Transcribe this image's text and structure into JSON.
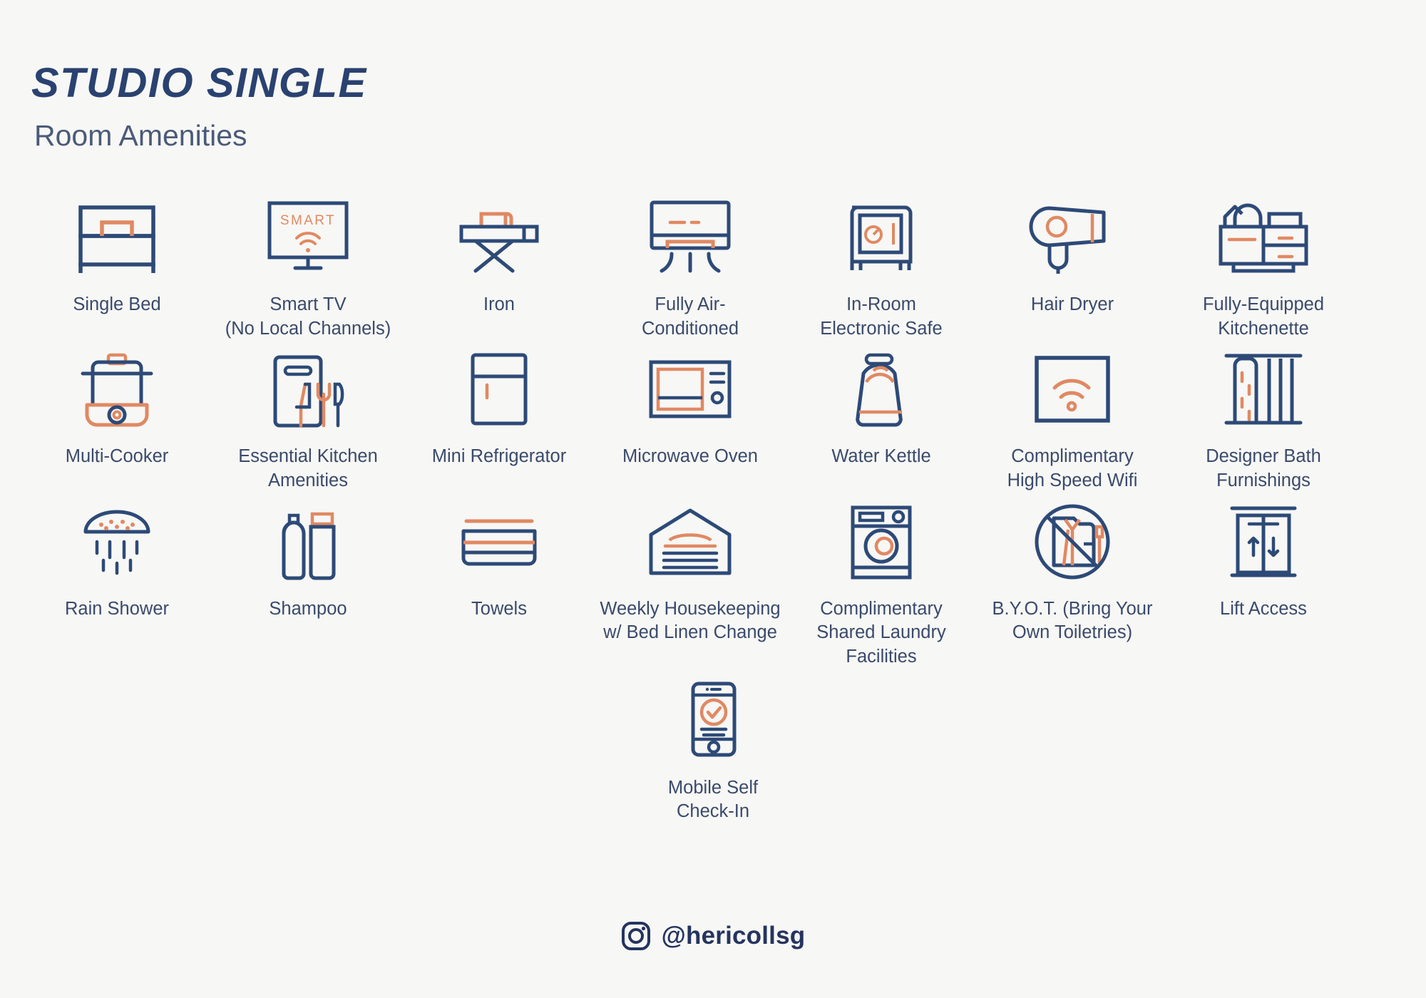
{
  "header": {
    "title": "STUDIO SINGLE",
    "subtitle": "Room Amenities"
  },
  "colors": {
    "background": "#f7f7f5",
    "navy": "#2d4a77",
    "title_navy": "#2a4270",
    "label_navy": "#3a4a6b",
    "accent_orange": "#e08963"
  },
  "amenities": {
    "rows": [
      [
        {
          "icon": "single-bed-icon",
          "label": "Single Bed"
        },
        {
          "icon": "smart-tv-icon",
          "label": "Smart TV\n(No Local Channels)",
          "line1": "Smart TV",
          "line2": "(No Local Channels)",
          "screen_text": "SMART"
        },
        {
          "icon": "iron-icon",
          "label": "Iron"
        },
        {
          "icon": "air-conditioner-icon",
          "label": "Fully Air-\nConditioned",
          "line1": "Fully Air-",
          "line2": "Conditioned"
        },
        {
          "icon": "safe-icon",
          "label": "In-Room\nElectronic Safe",
          "line1": "In-Room",
          "line2": "Electronic Safe"
        },
        {
          "icon": "hair-dryer-icon",
          "label": "Hair Dryer"
        },
        {
          "icon": "kitchenette-icon",
          "label": "Fully-Equipped\nKitchenette",
          "line1": "Fully-Equipped",
          "line2": "Kitchenette"
        }
      ],
      [
        {
          "icon": "multi-cooker-icon",
          "label": "Multi-Cooker"
        },
        {
          "icon": "kitchen-utensils-icon",
          "label": "Essential Kitchen\nAmenities",
          "line1": "Essential Kitchen",
          "line2": "Amenities"
        },
        {
          "icon": "mini-fridge-icon",
          "label": "Mini Refrigerator"
        },
        {
          "icon": "microwave-icon",
          "label": "Microwave Oven"
        },
        {
          "icon": "water-kettle-icon",
          "label": "Water Kettle"
        },
        {
          "icon": "wifi-icon",
          "label": "Complimentary\nHigh Speed Wifi",
          "line1": "Complimentary",
          "line2": "High Speed Wifi"
        },
        {
          "icon": "bath-furnishings-icon",
          "label": "Designer Bath\nFurnishings",
          "line1": "Designer Bath",
          "line2": "Furnishings"
        }
      ],
      [
        {
          "icon": "rain-shower-icon",
          "label": "Rain Shower"
        },
        {
          "icon": "shampoo-icon",
          "label": "Shampoo"
        },
        {
          "icon": "towels-icon",
          "label": "Towels"
        },
        {
          "icon": "housekeeping-icon",
          "label": "Weekly Housekeeping\nw/ Bed Linen Change",
          "line1": "Weekly Housekeeping",
          "line2": "w/ Bed Linen Change"
        },
        {
          "icon": "laundry-machine-icon",
          "label": "Complimentary\nShared Laundry\nFacilities",
          "line1": "Complimentary",
          "line2": "Shared Laundry",
          "line3": "Facilities"
        },
        {
          "icon": "no-toiletries-icon",
          "label": "B.Y.O.T. (Bring Your\nOwn Toiletries)",
          "line1": "B.Y.O.T. (Bring Your",
          "line2": "Own Toiletries)"
        },
        {
          "icon": "lift-icon",
          "label": "Lift Access"
        }
      ],
      [
        {
          "icon": "mobile-checkin-icon",
          "label": "Mobile Self\nCheck-In",
          "line1": "Mobile Self",
          "line2": "Check-In"
        }
      ]
    ]
  },
  "footer": {
    "icon": "instagram-icon",
    "handle": "@hericollsg"
  }
}
